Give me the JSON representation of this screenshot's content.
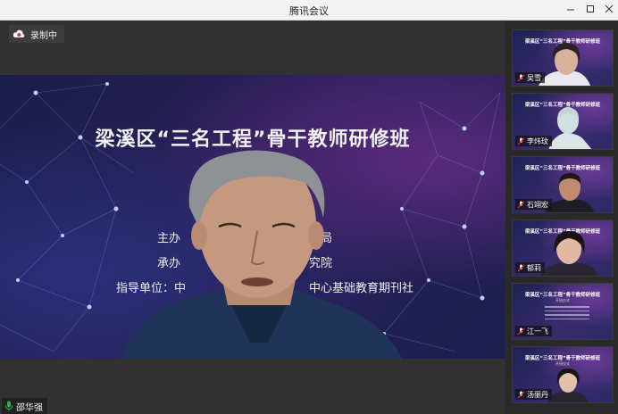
{
  "window": {
    "title": "腾讯会议"
  },
  "recording": {
    "label": "录制中"
  },
  "slide": {
    "title": "梁溪区“三名工程”骨干教师研修班",
    "lines": [
      "主办",
      "育局",
      "承办",
      "究院",
      "指导单位：中",
      "中心基础教育期刊社"
    ]
  },
  "speaker": {
    "name": "邵华强"
  },
  "participants": [
    {
      "name": "吴雪",
      "slide_title": "梁溪区“三名工程”骨干教师研修班",
      "slide_sub": "开班仪式"
    },
    {
      "name": "李炜玟",
      "slide_title": "梁溪区“三名工程”骨干教师研修班",
      "slide_sub": ""
    },
    {
      "name": "石翊宏",
      "slide_title": "梁溪区“三名工程”骨干教师研修班",
      "slide_sub": ""
    },
    {
      "name": "郁莉",
      "slide_title": "梁溪区“三名工程”骨干教师研修班",
      "slide_sub": ""
    },
    {
      "name": "江一飞",
      "slide_title": "梁溪区“三名工程”骨干教师研修班",
      "slide_sub": "开班仪式"
    },
    {
      "name": "汤丽丹",
      "slide_title": "梁溪区“三名工程”骨干教师研修班",
      "slide_sub": "开班仪式"
    }
  ],
  "colors": {
    "accent": "#d9343a",
    "slide_bg": "#1f1f52",
    "mic_on": "#2bb24c"
  }
}
